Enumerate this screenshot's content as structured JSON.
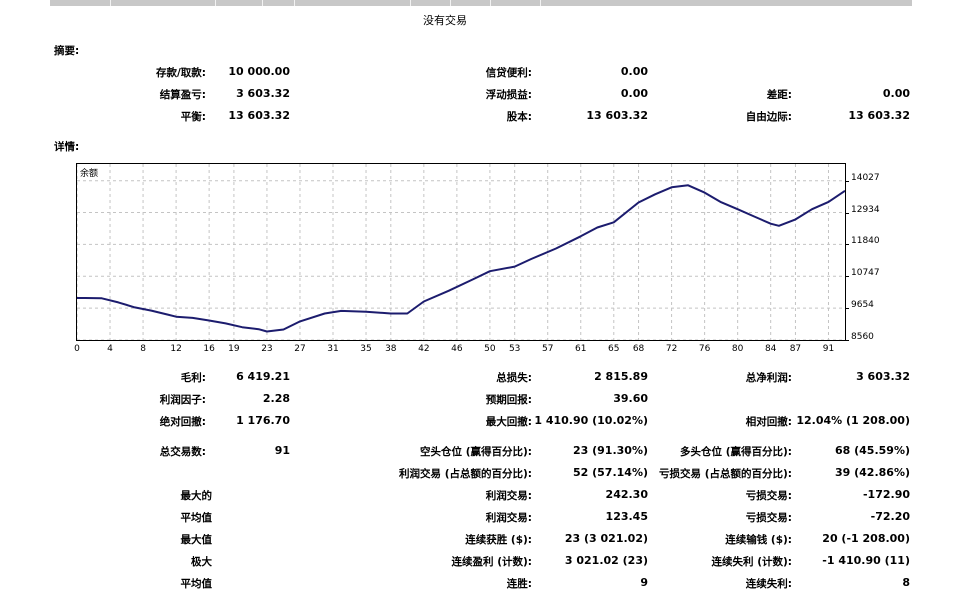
{
  "no_trades": "没有交易",
  "summary": {
    "heading": "摘要:",
    "deposit_label": "存款/取款:",
    "deposit_value": "10 000.00",
    "credit_label": "信贷便利:",
    "credit_value": "0.00",
    "closed_pl_label": "结算盈亏:",
    "closed_pl_value": "3 603.32",
    "floating_label": "浮动损益:",
    "floating_value": "0.00",
    "spread_label": "差距:",
    "spread_value": "0.00",
    "balance_label": "平衡:",
    "balance_value": "13 603.32",
    "equity_label": "股本:",
    "equity_value": "13 603.32",
    "free_margin_label": "自由边际:",
    "free_margin_value": "13 603.32"
  },
  "details": {
    "heading": "详情:",
    "gross_profit_label": "毛利:",
    "gross_profit_value": "6 419.21",
    "gross_loss_label": "总损失:",
    "gross_loss_value": "2 815.89",
    "net_profit_label": "总净利润:",
    "net_profit_value": "3 603.32",
    "profit_factor_label": "利润因子:",
    "profit_factor_value": "2.28",
    "expected_payoff_label": "预期回报:",
    "expected_payoff_value": "39.60",
    "abs_drawdown_label": "绝对回撤:",
    "abs_drawdown_value": "1 176.70",
    "max_drawdown_label": "最大回撤:",
    "max_drawdown_value": "1 410.90 (10.02%)",
    "rel_drawdown_label": "相对回撤:",
    "rel_drawdown_value": "12.04% (1 208.00)",
    "total_trades_label": "总交易数:",
    "total_trades_value": "91",
    "short_label": "空头仓位 (赢得百分比):",
    "short_value": "23 (91.30%)",
    "long_label": "多头仓位 (赢得百分比):",
    "long_value": "68 (45.59%)",
    "profit_trades_label": "利润交易 (占总额的百分比):",
    "profit_trades_value": "52 (57.14%)",
    "loss_trades_label": "亏损交易 (占总额的百分比):",
    "loss_trades_value": "39 (42.86%)",
    "largest_label": "最大的",
    "largest_profit_label": "利润交易:",
    "largest_profit_value": "242.30",
    "largest_loss_label": "亏损交易:",
    "largest_loss_value": "-172.90",
    "average_label": "平均值",
    "avg_profit_label": "利润交易:",
    "avg_profit_value": "123.45",
    "avg_loss_label": "亏损交易:",
    "avg_loss_value": "-72.20",
    "maximum_label": "最大值",
    "cons_wins_label": "连续获胜 ($):",
    "cons_wins_value": "23 (3 021.02)",
    "cons_losses_label": "连续输钱 ($):",
    "cons_losses_value": "20 (-1 208.00)",
    "maximal_label": "极大",
    "cons_profit_label": "连续盈利 (计数):",
    "cons_profit_value": "3 021.02 (23)",
    "cons_loss_label": "连续失利 (计数):",
    "cons_loss_value": "-1 410.90 (11)",
    "average2_label": "平均值",
    "avg_wins_label": "连胜:",
    "avg_wins_value": "9",
    "avg_loss_streak_label": "连续失利:",
    "avg_loss_streak_value": "8"
  },
  "chart_data": {
    "type": "line",
    "title": "余额",
    "line_color": "#1c1c6e",
    "grid": true,
    "xlim": [
      0,
      93
    ],
    "ylim": [
      8560,
      14600
    ],
    "x_ticks": [
      0,
      4,
      8,
      12,
      16,
      19,
      23,
      27,
      31,
      35,
      38,
      42,
      46,
      50,
      53,
      57,
      61,
      65,
      68,
      72,
      76,
      80,
      84,
      87,
      91
    ],
    "y_ticks": [
      8560,
      9654,
      10747,
      11840,
      12934,
      14027
    ],
    "series": [
      {
        "x": [
          0,
          1,
          3,
          5,
          7,
          9,
          11,
          12,
          14,
          16,
          18,
          20,
          22,
          23,
          25,
          27,
          30,
          32,
          35,
          38,
          40,
          42,
          45,
          48,
          50,
          53,
          55,
          58,
          61,
          63,
          65,
          68,
          70,
          72,
          74,
          76,
          78,
          80,
          82,
          84,
          85,
          87,
          89,
          91,
          93
        ],
        "y": [
          10000,
          10000,
          9990,
          9850,
          9680,
          9570,
          9430,
          9360,
          9320,
          9230,
          9130,
          9000,
          8930,
          8850,
          8920,
          9200,
          9470,
          9560,
          9530,
          9470,
          9470,
          9880,
          10250,
          10650,
          10920,
          11080,
          11340,
          11700,
          12120,
          12420,
          12600,
          13280,
          13560,
          13800,
          13870,
          13620,
          13290,
          13050,
          12800,
          12550,
          12480,
          12700,
          13050,
          13300,
          13680
        ]
      }
    ]
  }
}
